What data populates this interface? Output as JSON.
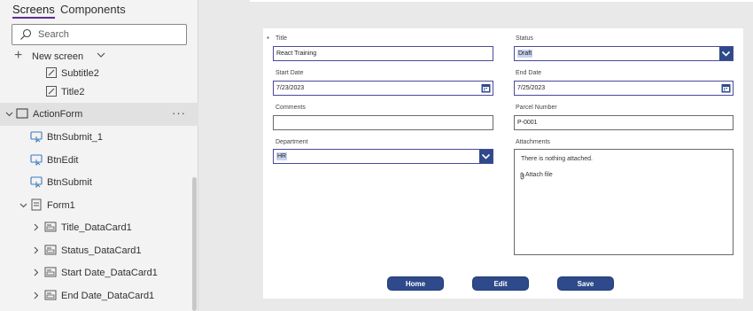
{
  "tree": {
    "tabs": {
      "screens": "Screens",
      "components": "Components"
    },
    "search_placeholder": "Search",
    "new_screen": "New screen",
    "items": [
      {
        "label": "Subtitle2",
        "icon": "edit-label-icon"
      },
      {
        "label": "Title2",
        "icon": "edit-label-icon"
      },
      {
        "label": "ActionForm",
        "icon": "screen-icon",
        "more": "···"
      },
      {
        "label": "BtnSubmit_1",
        "icon": "button-icon"
      },
      {
        "label": "BtnEdit",
        "icon": "button-icon"
      },
      {
        "label": "BtnSubmit",
        "icon": "button-icon"
      },
      {
        "label": "Form1",
        "icon": "form-icon"
      },
      {
        "label": "Title_DataCard1",
        "icon": "datacard-icon"
      },
      {
        "label": "Status_DataCard1",
        "icon": "datacard-icon"
      },
      {
        "label": "Start Date_DataCard1",
        "icon": "datacard-icon"
      },
      {
        "label": "End Date_DataCard1",
        "icon": "datacard-icon"
      }
    ]
  },
  "form": {
    "required_mark": "*",
    "title": {
      "label": "Title",
      "value": "React Training"
    },
    "status": {
      "label": "Status",
      "value": "Draft"
    },
    "start_date": {
      "label": "Start Date",
      "value": "7/23/2023"
    },
    "end_date": {
      "label": "End Date",
      "value": "7/25/2023"
    },
    "comments": {
      "label": "Comments",
      "value": ""
    },
    "parcel": {
      "label": "Parcel Number",
      "value": "P-0001"
    },
    "department": {
      "label": "Department",
      "value": "HR"
    },
    "attachments": {
      "label": "Attachments",
      "empty_text": "There is nothing attached.",
      "attach_label": "Attach file"
    },
    "buttons": {
      "home": "Home",
      "edit": "Edit",
      "save": "Save"
    }
  },
  "colors": {
    "accent": "#5c2d91",
    "button": "#2f4a8a",
    "selection": "#c7d2ee"
  }
}
